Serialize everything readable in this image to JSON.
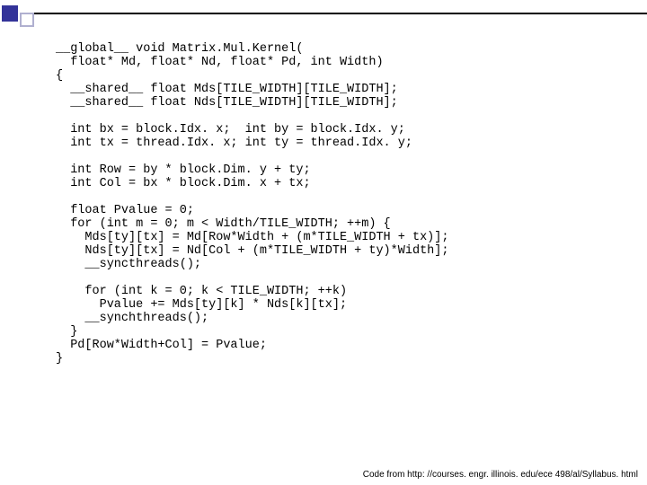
{
  "code": {
    "line01": "__global__ void Matrix.Mul.Kernel(",
    "line02": "  float* Md, float* Nd, float* Pd, int Width)",
    "line03": "{",
    "line04": "  __shared__ float Mds[TILE_WIDTH][TILE_WIDTH];",
    "line05": "  __shared__ float Nds[TILE_WIDTH][TILE_WIDTH];",
    "line06": "",
    "line07": "  int bx = block.Idx. x;  int by = block.Idx. y;",
    "line08": "  int tx = thread.Idx. x; int ty = thread.Idx. y;",
    "line09": "",
    "line10": "  int Row = by * block.Dim. y + ty;",
    "line11": "  int Col = bx * block.Dim. x + tx;",
    "line12": "",
    "line13": "  float Pvalue = 0;",
    "line14": "  for (int m = 0; m < Width/TILE_WIDTH; ++m) {",
    "line15": "    Mds[ty][tx] = Md[Row*Width + (m*TILE_WIDTH + tx)];",
    "line16": "    Nds[ty][tx] = Nd[Col + (m*TILE_WIDTH + ty)*Width];",
    "line17": "    __syncthreads();",
    "line18": "",
    "line19": "    for (int k = 0; k < TILE_WIDTH; ++k)",
    "line20": "      Pvalue += Mds[ty][k] * Nds[k][tx];",
    "line21": "    __synchthreads();",
    "line22": "  }",
    "line23": "  Pd[Row*Width+Col] = Pvalue;",
    "line24": "}"
  },
  "footnote": "Code from http: //courses. engr. illinois. edu/ece 498/al/Syllabus. html"
}
